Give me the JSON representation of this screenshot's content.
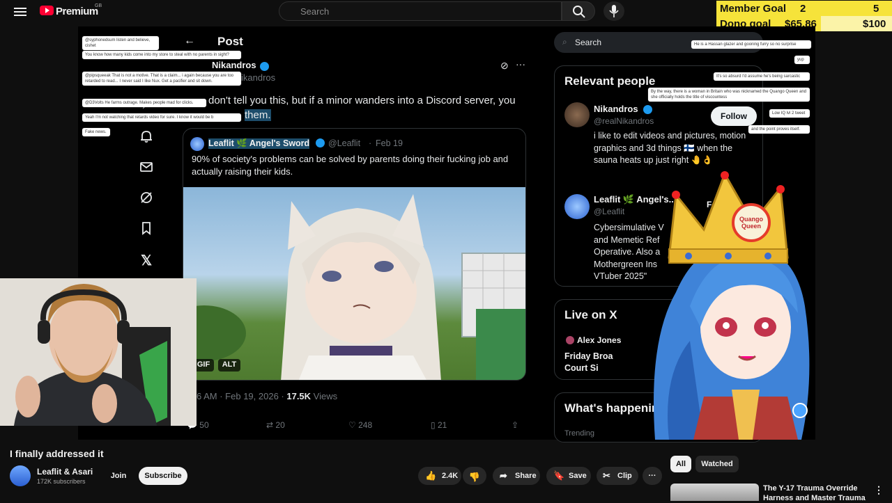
{
  "youtube": {
    "brand": "Premium",
    "region": "GB",
    "search_placeholder": "Search"
  },
  "goals": {
    "member_label": "Member Goal",
    "member_current": "2",
    "member_target": "5",
    "dono_label": "Dono goal",
    "dono_current": "$65.86",
    "dono_target": "$100"
  },
  "x_post": {
    "header": "Post",
    "author": "Nikandros",
    "handle_partial": "ikandros",
    "text_partial": "don't tell you this, but if a minor wanders into a Discord server, you",
    "text_partial2": "them.",
    "quote_author": "Leaflit 🌿 Angel's Sword",
    "quote_handle": "@Leaflit",
    "quote_date": "Feb 19",
    "quote_text": "90% of society's problems can be solved by parents doing their fucking job and actually raising their kids.",
    "badge_gif": "GIF",
    "badge_alt": "ALT",
    "meta_time": "6 AM · Feb 19, 2026 · ",
    "meta_views_count": "17.5K",
    "meta_views_label": " Views",
    "replies": "50",
    "reposts": "20",
    "likes": "248",
    "bookmarks": "21"
  },
  "x_right": {
    "search": "Search",
    "relevant_title": "Relevant people",
    "person1_name": "Nikandros",
    "person1_handle": "@realNikandros",
    "person1_bio": "i like to edit videos and pictures, motion graphics and 3d things 🇫🇮 when the sauna heats up just right 🤚👌",
    "follow": "Follow",
    "person2_name": "Leaflit 🌿 Angel's...",
    "person2_handle": "@Leaflit",
    "following": "Followi",
    "person2_bio": "Cybersimulative V and Memetic Ref Operative. Also a Mothergreen Ins VTuber 2025\"",
    "live_title": "Live on X",
    "live_host": "Alex Jones",
    "live_event1": "Friday Broa",
    "live_event2": "Court Si",
    "happening_title": "What's happening",
    "trending": "Trending"
  },
  "vtuber_crown": "Quango Queen",
  "chat_messages": [
    "@syphonedsum listen and believe, cishet",
    "You know how many kids come into my store to steal with no parents in sight?",
    "@pipsqueeak That is not a motive. That is a claim... i again because you are too retarded to read... I never said I like Nux. Get a pacifier and sit down.",
    "@D3Volts He farms outrage. Makes people mad for clicks.",
    "Yeah I'm not watching that retards video for sure. I know it would be b",
    "Fake news.",
    "He is a Hassan glazer and gooning furry so no surprise",
    "yup",
    "It's so absurd I'd assume he's being sarcastic",
    "By the way, there is a woman in Britain who was nicknamed the Quango Queen and she officially holds the title of viscountess",
    "Low IQ lvl 2 tweet",
    "and the point proves itself."
  ],
  "video": {
    "title": "I finally addressed it",
    "channel": "Leaflit & Asari",
    "subscribers": "172K subscribers",
    "join": "Join",
    "subscribe": "Subscribe",
    "likes": "2.4K",
    "share": "Share",
    "save": "Save",
    "clip": "Clip",
    "more": "···"
  },
  "chips": {
    "all": "All",
    "watched": "Watched"
  },
  "recommendation": {
    "title": "The Y-17 Trauma Override",
    "subtitle": "Harness and Master Trauma"
  },
  "colors": {
    "goal_yellow": "#f6e33a",
    "x_blue": "#1d9bf0",
    "yt_red": "#ff0033"
  }
}
